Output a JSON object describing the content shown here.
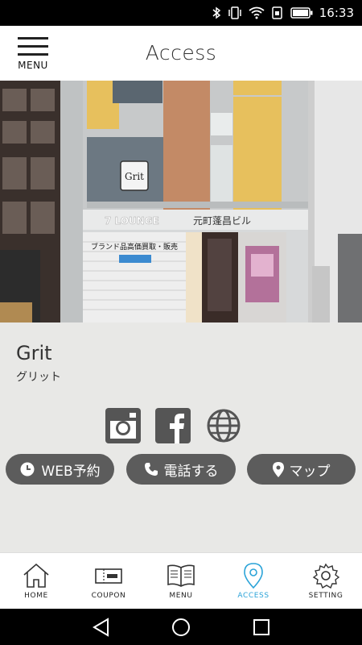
{
  "status_bar": {
    "time": "16:33"
  },
  "header": {
    "menu_label": "MENU",
    "title": "Access"
  },
  "shop": {
    "name": "Grit",
    "kana": "グリット",
    "sign_text": "Grit",
    "shutter_text": "ブランド品高価買取・販売",
    "building_sign": "元町蓬昌ビル"
  },
  "actions": {
    "web_reserve": "WEB予約",
    "call": "電話する",
    "map": "マップ"
  },
  "tabs": [
    {
      "label": "HOME",
      "icon": "home-icon"
    },
    {
      "label": "COUPON",
      "icon": "coupon-icon"
    },
    {
      "label": "MENU",
      "icon": "book-icon"
    },
    {
      "label": "ACCESS",
      "icon": "location-pin-icon"
    },
    {
      "label": "SETTING",
      "icon": "gear-icon"
    }
  ],
  "colors": {
    "accent": "#2aa3d8",
    "pill": "#5c5c5c",
    "panel": "#e8e8e6"
  }
}
